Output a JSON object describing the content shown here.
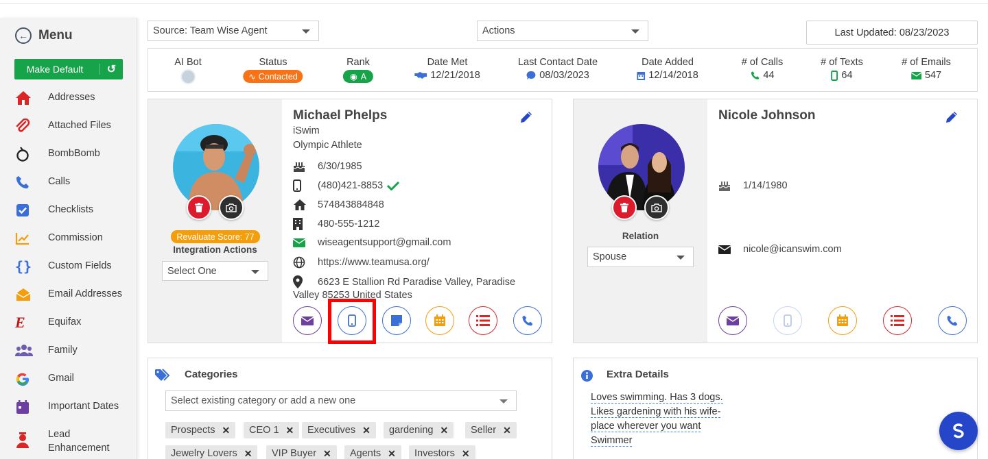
{
  "sidebar": {
    "title": "Menu",
    "make_default": "Make Default",
    "items": [
      {
        "label": "Addresses",
        "icon": "home-icon"
      },
      {
        "label": "Attached Files",
        "icon": "paperclip-icon"
      },
      {
        "label": "BombBomb",
        "icon": "bombbomb-icon"
      },
      {
        "label": "Calls",
        "icon": "phone-icon"
      },
      {
        "label": "Checklists",
        "icon": "checkbox-icon"
      },
      {
        "label": "Commission",
        "icon": "chart-icon"
      },
      {
        "label": "Custom Fields",
        "icon": "braces-icon"
      },
      {
        "label": "Email Addresses",
        "icon": "envelope-open-icon"
      },
      {
        "label": "Equifax",
        "icon": "equifax-icon"
      },
      {
        "label": "Family",
        "icon": "users-icon"
      },
      {
        "label": "Gmail",
        "icon": "google-icon"
      },
      {
        "label": "Important Dates",
        "icon": "calendar-icon"
      },
      {
        "label": "Lead Enhancement",
        "icon": "user-icon"
      }
    ]
  },
  "toolbar": {
    "source_select": "Source: Team Wise Agent",
    "actions_select": "Actions",
    "last_updated": "Last Updated: 08/23/2023"
  },
  "stats": {
    "ai_bot": "AI Bot",
    "status_label": "Status",
    "status_value": "Contacted",
    "rank_label": "Rank",
    "rank_value": "A",
    "date_met_label": "Date Met",
    "date_met_value": "12/21/2018",
    "last_contact_label": "Last Contact Date",
    "last_contact_value": "08/03/2023",
    "date_added_label": "Date Added",
    "date_added_value": "12/14/2018",
    "calls_label": "# of Calls",
    "calls_value": "44",
    "texts_label": "# of Texts",
    "texts_value": "64",
    "emails_label": "# of Emails",
    "emails_value": "547"
  },
  "primary": {
    "name": "Michael Phelps",
    "company": "iSwim",
    "title": "Olympic Athlete",
    "birthday": "6/30/1985",
    "mobile": "(480)421-8853",
    "home": "574843884848",
    "work": "480-555-1212",
    "email": "wiseagentsupport@gmail.com",
    "website": "https://www.teamusa.org/",
    "address_line1": "6623 E Stallion Rd Paradise Valley, Paradise",
    "address_line2": "Valley 85253 United States",
    "score": "Revaluate Score: 77",
    "integration_label": "Integration Actions",
    "integration_select": "Select One"
  },
  "spouse": {
    "name": "Nicole Johnson",
    "birthday": "1/14/1980",
    "email": "nicole@icanswim.com",
    "relation_label": "Relation",
    "relation_value": "Spouse"
  },
  "categories": {
    "title": "Categories",
    "placeholder": "Select existing category or add a new one",
    "tags": [
      "Prospects",
      "CEO 1",
      "Executives",
      "gardening",
      "Seller",
      "Jewelry Lovers",
      "VIP Buyer",
      "Agents",
      "Investors"
    ]
  },
  "extra": {
    "title": "Extra Details",
    "lines": [
      "Loves swimming. Has 3 dogs.",
      "Likes gardening with his wife-",
      "place wherever you want",
      "Swimmer"
    ]
  },
  "colors": {
    "green": "#16a34a",
    "orange": "#f59e0b",
    "blue": "#2563eb",
    "purple": "#6d3fa0",
    "red": "#dc2626",
    "highlight": "#ff0000"
  }
}
